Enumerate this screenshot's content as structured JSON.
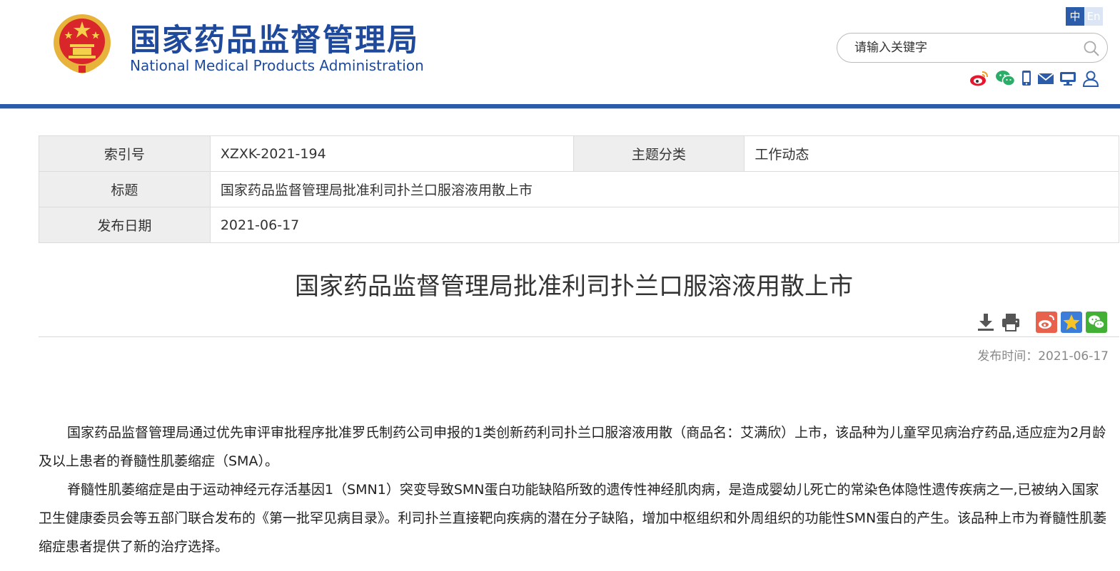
{
  "header": {
    "site_name_cn": "国家药品监督管理局",
    "site_name_en": "National Medical Products Administration",
    "lang_cn": "中",
    "lang_en": "En",
    "search_placeholder": "请输入关键字",
    "social_icons": [
      "weibo-icon",
      "wechat-icon",
      "mobile-icon",
      "mail-icon",
      "monitor-icon",
      "user-icon"
    ],
    "brand_color": "#2a5caa"
  },
  "info": {
    "index_label": "索引号",
    "index_value": "XZXK-2021-194",
    "category_label": "主题分类",
    "category_value": "工作动态",
    "title_label": "标题",
    "title_value": "国家药品监督管理局批准利司扑兰口服溶液用散上市",
    "date_label": "发布日期",
    "date_value": "2021-06-17"
  },
  "article": {
    "title": "国家药品监督管理局批准利司扑兰口服溶液用散上市",
    "tools": [
      "download-icon",
      "print-icon",
      "share-weibo-icon",
      "favorite-icon",
      "share-wechat-icon"
    ],
    "publish_time": "发布时间：2021-06-17",
    "paragraphs": [
      "国家药品监督管理局通过优先审评审批程序批准罗氏制药公司申报的1类创新药利司扑兰口服溶液用散（商品名：艾满欣）上市，该品种为儿童罕见病治疗药品,适应症为2月龄及以上患者的脊髓性肌萎缩症（SMA）。",
      "脊髓性肌萎缩症是由于运动神经元存活基因1（SMN1）突变导致SMN蛋白功能缺陷所致的遗传性神经肌肉病，是造成婴幼儿死亡的常染色体隐性遗传疾病之一,已被纳入国家卫生健康委员会等五部门联合发布的《第一批罕见病目录》。利司扑兰直接靶向疾病的潜在分子缺陷，增加中枢组织和外周组织的功能性SMN蛋白的产生。该品种上市为脊髓性肌萎缩症患者提供了新的治疗选择。"
    ]
  }
}
